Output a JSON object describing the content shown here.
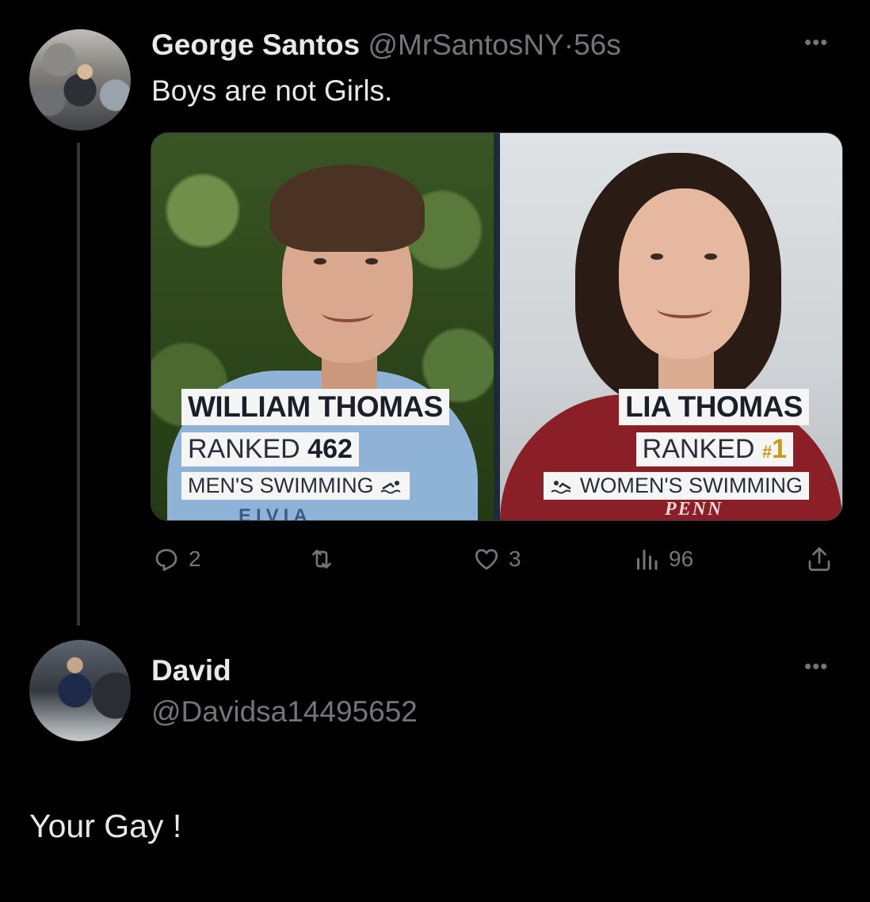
{
  "tweet1": {
    "author_name": "George Santos",
    "handle": "@MrSantosNY",
    "separator": "·",
    "time": "56s",
    "text": "Boys are not Girls.",
    "more_label": "•••",
    "media": {
      "left": {
        "name": "WILLIAM THOMAS",
        "rank_label": "RANKED",
        "rank_value": "462",
        "sport": "MEN'S SWIMMING",
        "shirt_text": "EIVIA"
      },
      "right": {
        "name": "LIA THOMAS",
        "rank_label": "RANKED",
        "rank_hash": "#",
        "rank_value": "1",
        "sport": "WOMEN'S SWIMMING",
        "shirt_text": "PENN"
      }
    },
    "actions": {
      "replies": "2",
      "retweets": "",
      "likes": "3",
      "views": "96"
    }
  },
  "tweet2": {
    "author_name": "David",
    "handle": "@Davidsa14495652",
    "more_label": "•••",
    "text": "Your Gay !"
  },
  "icons": {
    "reply": "reply-icon",
    "retweet": "retweet-icon",
    "like": "heart-icon",
    "views": "views-icon",
    "share": "share-icon",
    "swimmer": "swimmer-icon"
  },
  "colors": {
    "background": "#000000",
    "text_primary": "#e7e9ea",
    "text_secondary": "#71767b",
    "rank_gold": "#c79a1c"
  }
}
